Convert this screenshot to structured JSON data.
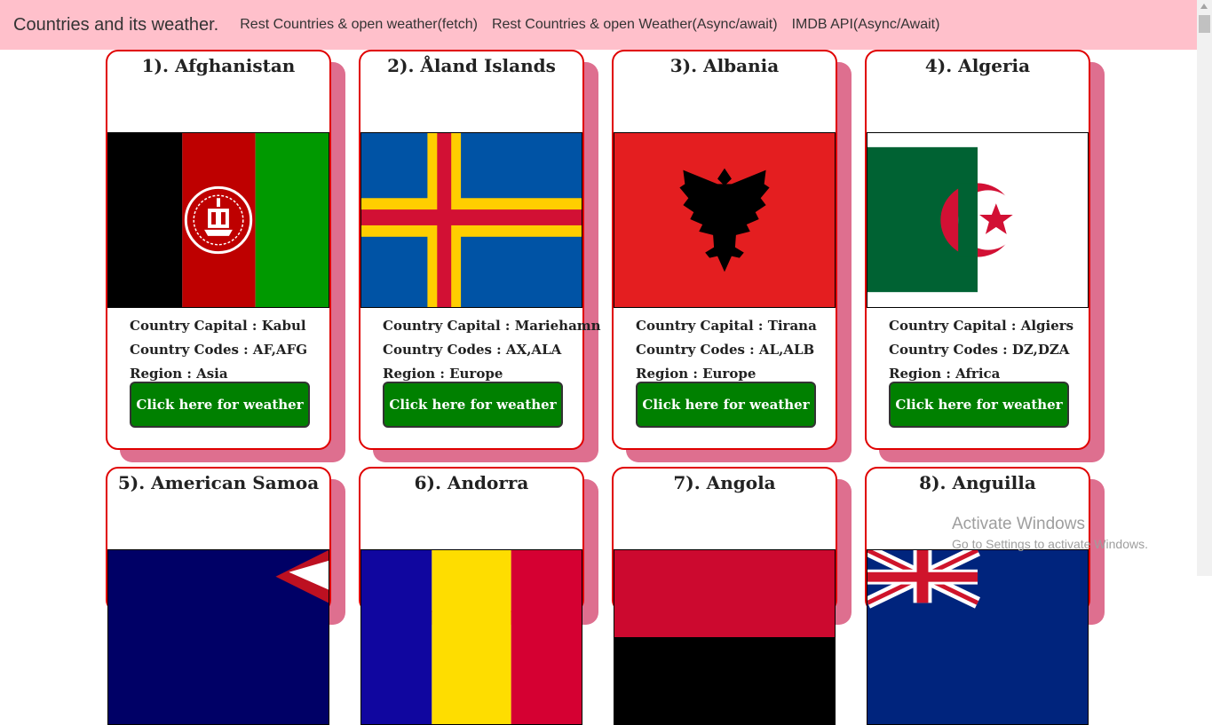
{
  "navbar": {
    "brand": "Countries and its weather.",
    "links": [
      "Rest Countries & open weather(fetch)",
      "Rest Countries & open Weather(Async/await)",
      "IMDB API(Async/Await)"
    ]
  },
  "cards": [
    {
      "title": "1). Afghanistan",
      "capital": "Country Capital : Kabul",
      "codes": "Country Codes : AF,AFG",
      "region": "Region : Asia",
      "button": "Click here for weather"
    },
    {
      "title": "2). Åland Islands",
      "capital": "Country Capital : Mariehamn",
      "codes": "Country Codes : AX,ALA",
      "region": "Region : Europe",
      "button": "Click here for weather"
    },
    {
      "title": "3). Albania",
      "capital": "Country Capital : Tirana",
      "codes": "Country Codes : AL,ALB",
      "region": "Region : Europe",
      "button": "Click here for weather"
    },
    {
      "title": "4). Algeria",
      "capital": "Country Capital : Algiers",
      "codes": "Country Codes : DZ,DZA",
      "region": "Region : Africa",
      "button": "Click here for weather"
    },
    {
      "title": "5). American Samoa"
    },
    {
      "title": "6). Andorra"
    },
    {
      "title": "7). Angola"
    },
    {
      "title": "8). Anguilla"
    }
  ],
  "watermark": {
    "line1": "Activate Windows",
    "line2": "Go to Settings to activate Windows."
  },
  "colors": {
    "navbar_bg": "#ffc0cb",
    "card_border": "#e00000",
    "card_shadow": "#de6f8f",
    "button_bg": "#008000"
  }
}
